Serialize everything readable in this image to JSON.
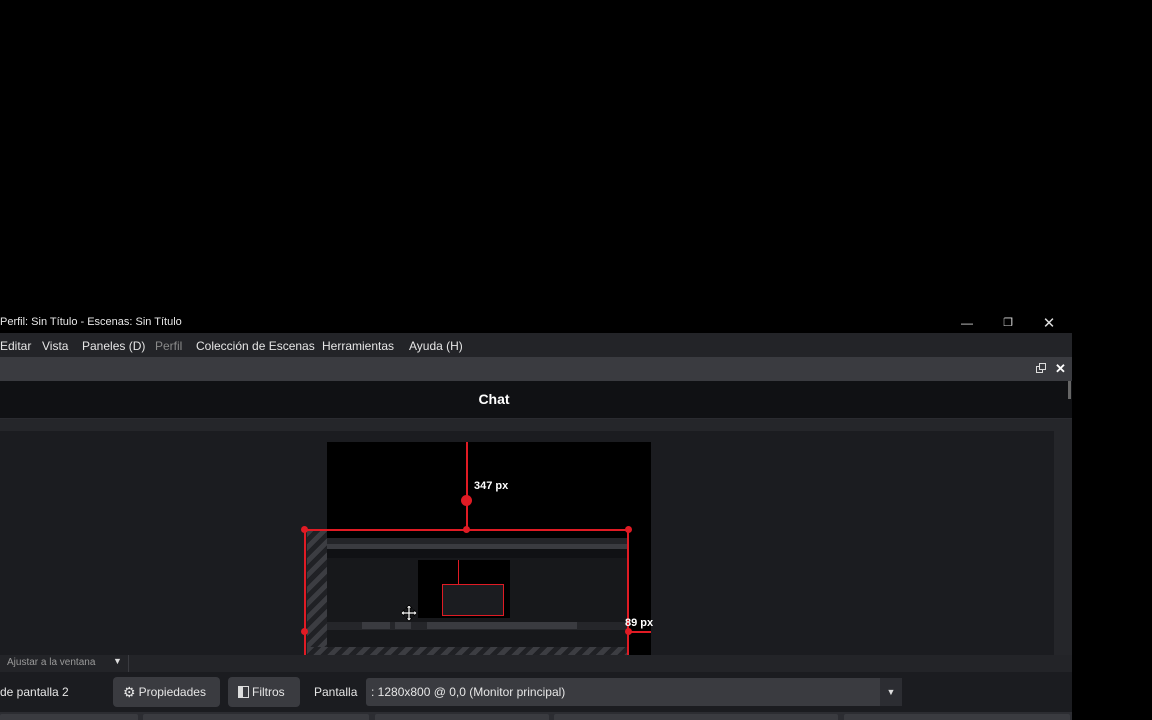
{
  "window": {
    "title": "Perfil: Sin Título - Escenas: Sin Título",
    "minimize_icon": "minimize-icon",
    "maximize_icon": "restore-icon",
    "close_icon": "close-icon"
  },
  "menu": {
    "items": [
      {
        "label": "Editar",
        "disabled": false
      },
      {
        "label": "Vista",
        "disabled": false
      },
      {
        "label": "Paneles (D)",
        "disabled": false
      },
      {
        "label": "Perfil",
        "disabled": true
      },
      {
        "label": "Colección de Escenas",
        "disabled": false
      },
      {
        "label": "Herramientas",
        "disabled": false
      },
      {
        "label": "Ayuda (H)",
        "disabled": false
      }
    ]
  },
  "dock": {
    "float_icon": "float-icon",
    "close_icon": "close-icon"
  },
  "chat": {
    "title": "Chat"
  },
  "preview": {
    "top_measure": "347 px",
    "right_measure": "89 px",
    "accent_color": "#e01b24"
  },
  "zoom": {
    "label": "Ajustar a la ventana"
  },
  "toolbar": {
    "source_name": "de pantalla 2",
    "properties_label": "Propiedades",
    "filters_label": "Filtros",
    "screen_label": "Pantalla",
    "screen_value": ": 1280x800 @ 0,0 (Monitor principal)"
  }
}
